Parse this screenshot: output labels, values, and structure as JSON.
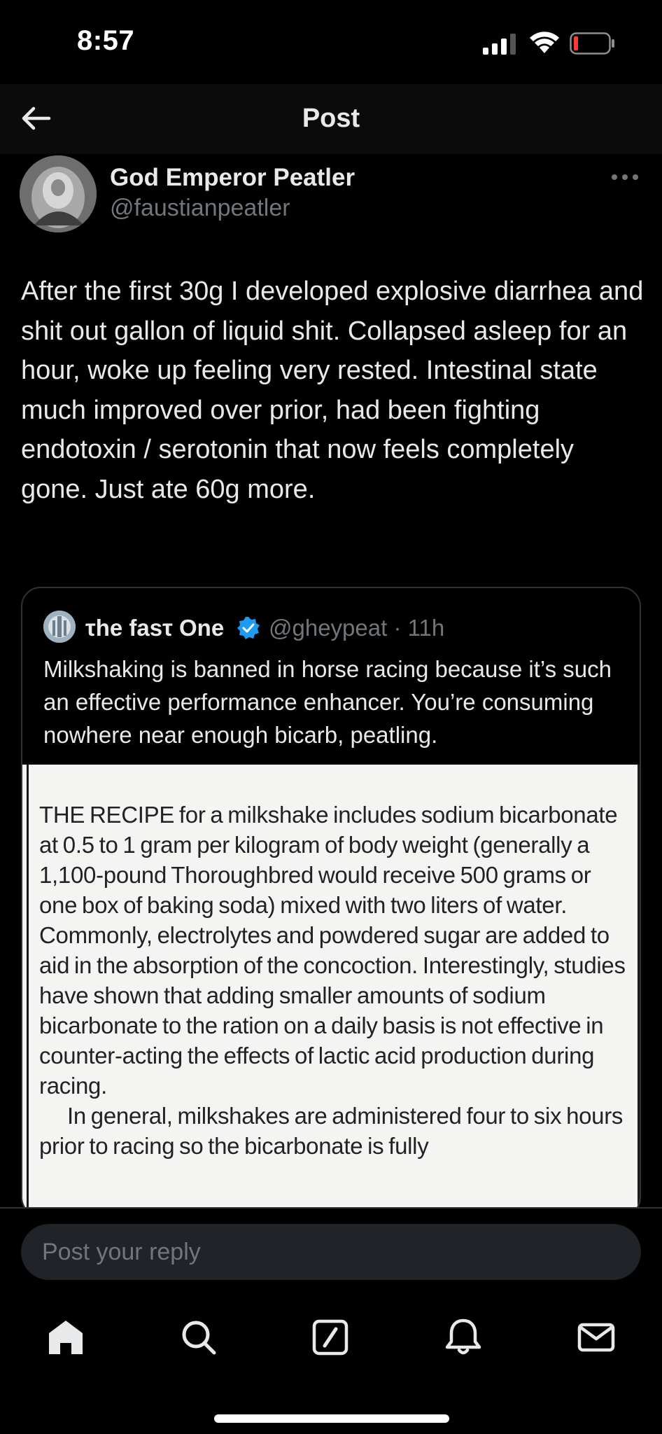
{
  "status_bar": {
    "time": "8:57"
  },
  "header": {
    "title": "Post"
  },
  "author": {
    "display_name": "God Emperor Peatler",
    "handle": "@faustianpeatler"
  },
  "post": {
    "text": "After the first 30g I developed explosive diarrhea and shit out gallon of liquid shit. Collapsed asleep for an hour, woke up feeling very rested. Intestinal state much improved over prior, had been fighting endotoxin / serotonin that now feels completely gone. Just ate 60g more."
  },
  "quote": {
    "display_name": "τhe fasτ One",
    "handle_time": "@gheypeat · 11h",
    "text": "Milkshaking is banned in horse racing because it’s such an effective performance enhancer. You’re consuming nowhere near enough bicarb, peatling.",
    "image_text": {
      "paragraph1": "THE RECIPE for a milkshake includes sodium bicarbonate at 0.5 to 1 gram per kilogram of body weight (generally a 1,100-pound Thoroughbred would receive 500 grams or one box of baking soda) mixed with two liters of water. Commonly, electrolytes and powdered sugar are added to aid in the absorption of the concoction. Interestingly, studies have shown that adding smaller amounts of sodium bicarbonate to the ration on a daily basis is not effective in counter-acting the effects of lactic acid production during racing.",
      "paragraph2": "In general, milkshakes are administered four to six hours prior to racing so the bicarbonate is fully"
    }
  },
  "reply": {
    "placeholder": "Post your reply"
  },
  "tabs": {
    "home": "home-icon",
    "search": "search-icon",
    "compose": "compose-icon",
    "notifications": "bell-icon",
    "messages": "mail-icon"
  },
  "colors": {
    "background": "#000000",
    "text_primary": "#e7e9ea",
    "text_secondary": "#71767b",
    "verified": "#1d9bf0",
    "battery_low": "#ff3b30"
  }
}
